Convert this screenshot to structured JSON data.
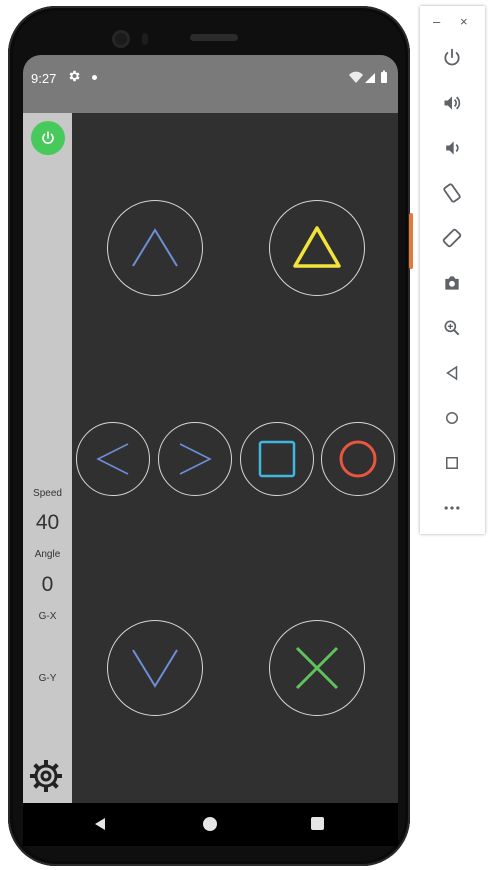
{
  "status_bar": {
    "time": "9:27"
  },
  "sidebar": {
    "speed_label": "Speed",
    "speed_value": "40",
    "angle_label": "Angle",
    "angle_value": "0",
    "gx_label": "G-X",
    "gy_label": "G-Y"
  },
  "colors": {
    "power_green": "#47c95c",
    "arrow_blue": "#6c8fd8",
    "triangle_yellow": "#f2e43a",
    "square_cyan": "#3fb8e0",
    "circle_red": "#e8563f",
    "cross_green": "#5ec25e",
    "screen_bg": "#303030",
    "sidebar_bg": "#c8c8c8"
  },
  "icons": [
    "power-icon",
    "gear-icon",
    "up-arrow-icon",
    "down-arrow-icon",
    "left-arrow-icon",
    "right-arrow-icon",
    "triangle-icon",
    "square-icon",
    "circle-icon",
    "cross-icon",
    "back-icon",
    "home-icon",
    "recents-icon",
    "volume-up-icon",
    "volume-down-icon",
    "rotate-left-icon",
    "rotate-right-icon",
    "camera-icon",
    "zoom-icon",
    "more-icon"
  ],
  "emulator_toolbar": {
    "minimize": "–",
    "close": "×"
  }
}
